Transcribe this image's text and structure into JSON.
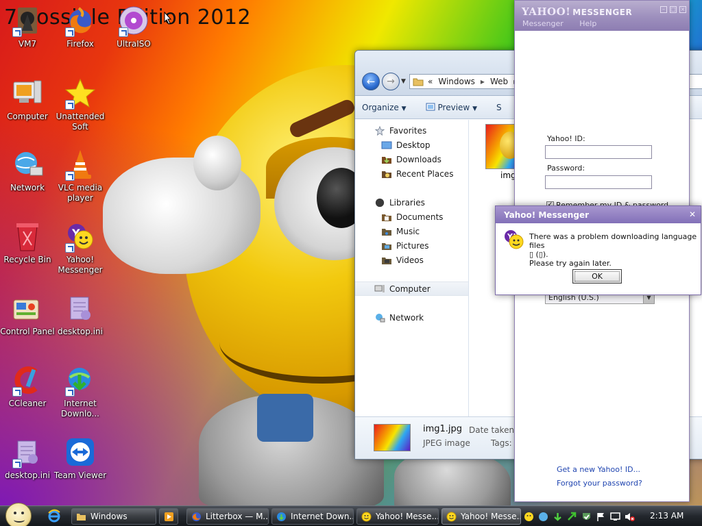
{
  "wallpaper": {
    "title": "7 Possible Edition 2012"
  },
  "desktop_icons": [
    {
      "label": "VM7"
    },
    {
      "label": "Firefox"
    },
    {
      "label": "UltraISO"
    },
    {
      "label": "Computer"
    },
    {
      "label": "Unattended Soft"
    },
    {
      "label": "Network"
    },
    {
      "label": "VLC media player"
    },
    {
      "label": "Recycle Bin"
    },
    {
      "label": "Yahoo! Messenger"
    },
    {
      "label": "Control Panel"
    },
    {
      "label": "desktop.ini"
    },
    {
      "label": "CCleaner"
    },
    {
      "label": "Internet Downlo..."
    },
    {
      "label": "desktop.ini"
    },
    {
      "label": "Team Viewer"
    }
  ],
  "explorer": {
    "breadcrumb": [
      "«",
      "Windows",
      "Web"
    ],
    "commands": [
      "Organize",
      "Preview",
      "S"
    ],
    "nav": {
      "favorites": "Favorites",
      "favorite_items": [
        "Desktop",
        "Downloads",
        "Recent Places"
      ],
      "libraries": "Libraries",
      "library_items": [
        "Documents",
        "Music",
        "Pictures",
        "Videos"
      ],
      "computer": "Computer",
      "network": "Network"
    },
    "file_caption": "img1",
    "details": {
      "name": "img1.jpg",
      "type": "JPEG image",
      "date_label": "Date taken:",
      "tags_label": "Tags:"
    }
  },
  "messenger": {
    "title_logo": "YAHOO!",
    "title_text": "MESSENGER",
    "menu": [
      "Messenger",
      "Help"
    ],
    "id_label": "Yahoo! ID:",
    "password_label": "Password:",
    "remember_label": "Remember my ID & password",
    "language": "English (U.S.)",
    "link_new_id": "Get a new Yahoo! ID...",
    "link_forgot": "Forgot your password?"
  },
  "dialog": {
    "title": "Yahoo! Messenger",
    "line1": "There was a problem downloading language files",
    "line2": "▯ (▯).",
    "line3": "Please try again later.",
    "ok_label": "OK"
  },
  "taskbar": {
    "buttons": [
      {
        "label": "Windows"
      },
      {
        "label": "Litterbox — M..."
      },
      {
        "label": "Internet Down..."
      },
      {
        "label": "Yahoo! Messe..."
      },
      {
        "label": "Yahoo! Messe..."
      }
    ],
    "clock": "2:13 AM"
  },
  "colors": {
    "yahoo_purple": "#8270b8",
    "link_blue": "#2045b0",
    "taskbar_dark": "#23272d"
  }
}
